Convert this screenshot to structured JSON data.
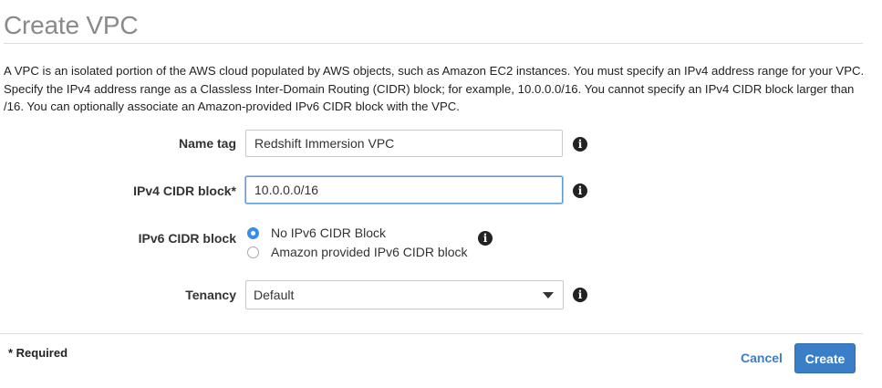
{
  "page": {
    "title": "Create VPC",
    "description": "A VPC is an isolated portion of the AWS cloud populated by AWS objects, such as Amazon EC2 instances. You must specify an IPv4 address range for your VPC. Specify the IPv4 address range as a Classless Inter-Domain Routing (CIDR) block; for example, 10.0.0.0/16. You cannot specify an IPv4 CIDR block larger than /16. You can optionally associate an Amazon-provided IPv6 CIDR block with the VPC."
  },
  "form": {
    "name_tag": {
      "label": "Name tag",
      "value": "Redshift Immersion VPC",
      "info_icon": "info-icon"
    },
    "ipv4_cidr": {
      "label": "IPv4 CIDR block*",
      "value": "10.0.0.0/16",
      "info_icon": "info-icon"
    },
    "ipv6_cidr": {
      "label": "IPv6 CIDR block",
      "options": [
        {
          "label": "No IPv6 CIDR Block",
          "selected": true
        },
        {
          "label": "Amazon provided IPv6 CIDR block",
          "selected": false
        }
      ],
      "info_icon": "info-icon"
    },
    "tenancy": {
      "label": "Tenancy",
      "value": "Default",
      "info_icon": "info-icon"
    }
  },
  "footer": {
    "required_note": "* Required",
    "cancel_label": "Cancel",
    "create_label": "Create"
  },
  "colors": {
    "accent": "#3b7ec8",
    "radio_selected": "#3b8ee0",
    "title": "#8a8a8a"
  }
}
